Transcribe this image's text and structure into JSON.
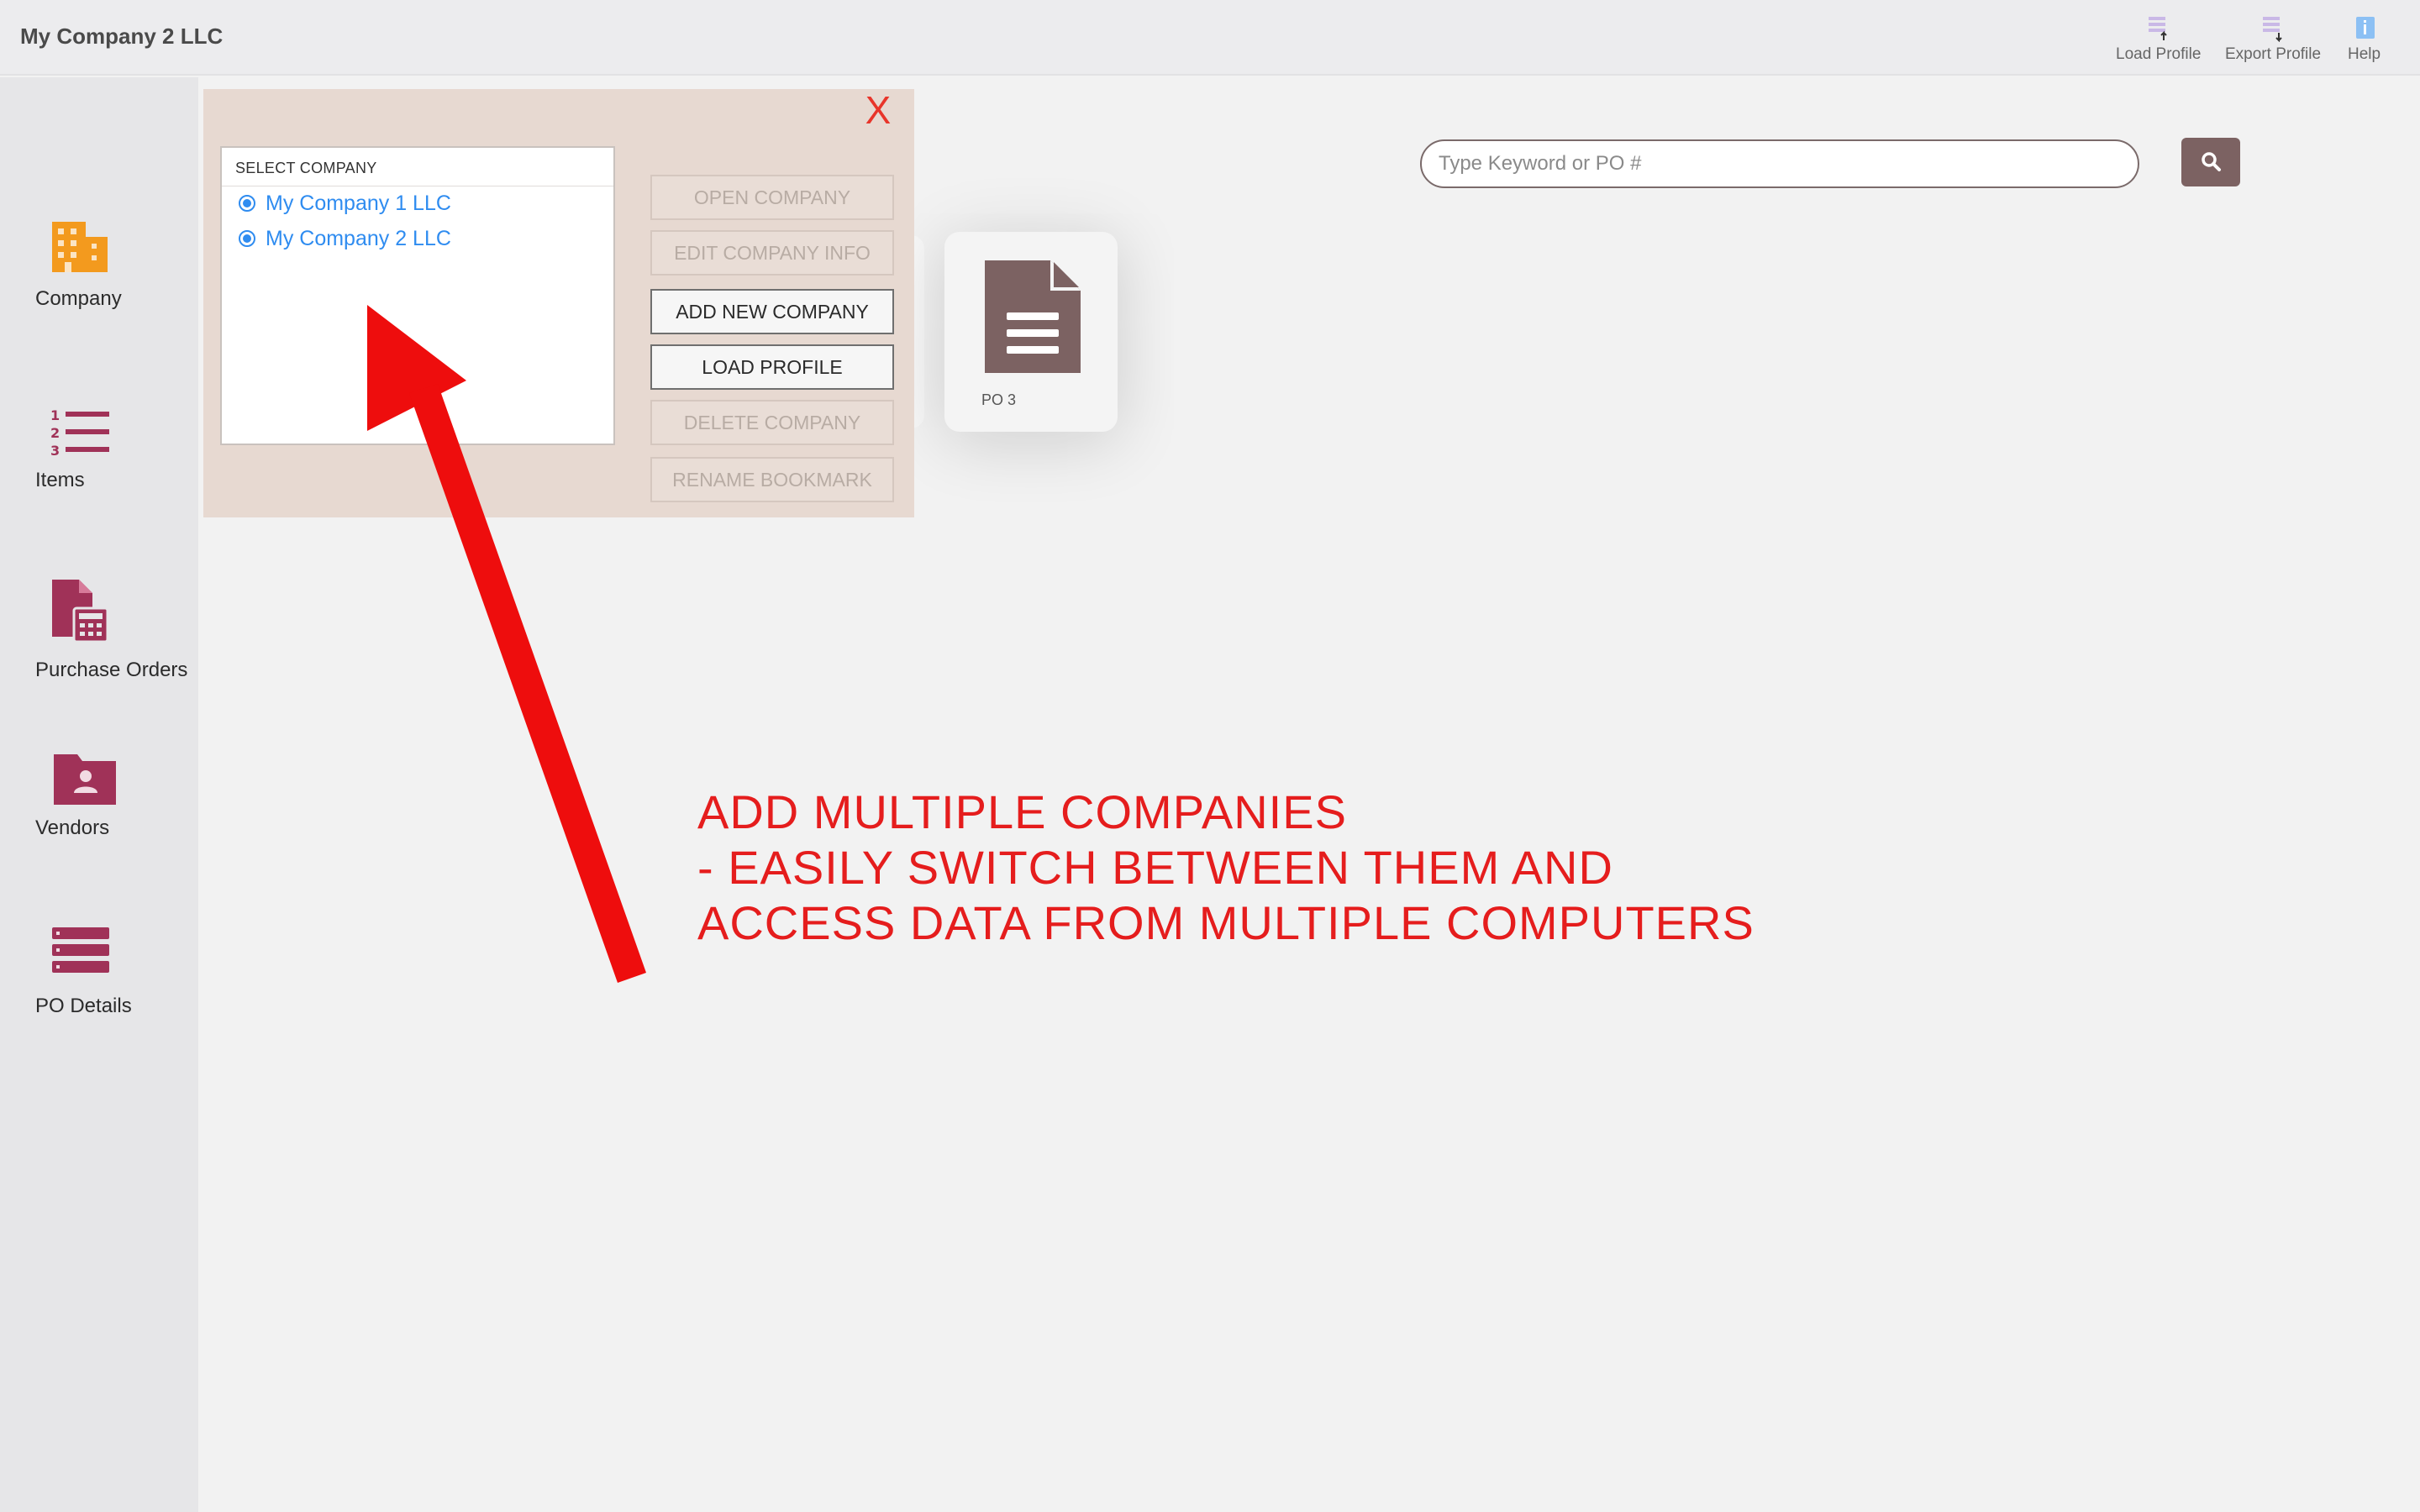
{
  "app": {
    "title": "My Company 2 LLC"
  },
  "top_actions": [
    {
      "label": "Load Profile",
      "icon": "load-profile-icon"
    },
    {
      "label": "Export Profile",
      "icon": "export-profile-icon"
    },
    {
      "label": "Help",
      "icon": "help-icon"
    }
  ],
  "sidebar": {
    "items": [
      {
        "label": "Company",
        "icon": "building-icon",
        "color": "#f39a1e"
      },
      {
        "label": "Items",
        "icon": "numbered-list-icon",
        "color": "#a03258"
      },
      {
        "label": "Purchase Orders",
        "icon": "document-calculator-icon",
        "color": "#a03258"
      },
      {
        "label": "Vendors",
        "icon": "vendor-folder-icon",
        "color": "#a03258"
      },
      {
        "label": "PO Details",
        "icon": "stacked-list-icon",
        "color": "#a03258"
      }
    ]
  },
  "search": {
    "placeholder": "Type Keyword or PO #",
    "value": "",
    "button_icon": "search-icon"
  },
  "po_card": {
    "label": "PO 3",
    "icon": "document-icon"
  },
  "dialog": {
    "close_label": "X",
    "list_header": "SELECT COMPANY",
    "companies": [
      {
        "name": "My Company 1 LLC",
        "selected": true
      },
      {
        "name": "My Company 2 LLC",
        "selected": true
      }
    ],
    "buttons": [
      {
        "label": "OPEN COMPANY",
        "enabled": false
      },
      {
        "label": "EDIT COMPANY INFO",
        "enabled": false
      },
      {
        "label": "ADD NEW COMPANY",
        "enabled": true
      },
      {
        "label": "LOAD PROFILE",
        "enabled": true
      },
      {
        "label": "DELETE COMPANY",
        "enabled": false
      },
      {
        "label": "RENAME BOOKMARK",
        "enabled": false
      }
    ]
  },
  "annotation": {
    "lines": [
      "ADD MULTIPLE COMPANIES",
      "- EASILY SWITCH BETWEEN THEM AND",
      "ACCESS DATA FROM MULTIPLE COMPUTERS"
    ],
    "color": "#e51d1d"
  },
  "colors": {
    "accent": "#7c6262",
    "link": "#2f8cf0",
    "close": "#e8352a",
    "dialog_bg": "#e7d9d1"
  }
}
